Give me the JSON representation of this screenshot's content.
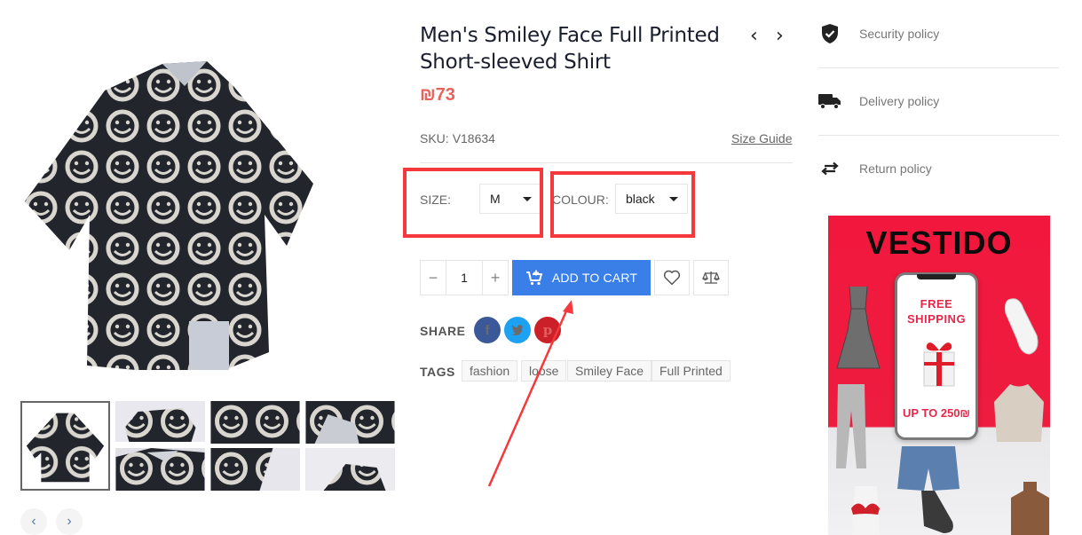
{
  "product": {
    "title": "Men's Smiley Face Full Printed Short-sleeved Shirt",
    "price": "₪73",
    "sku_label": "SKU:",
    "sku_value": "V18634",
    "size_guide": "Size Guide",
    "prev_product": "‹",
    "next_product": "›"
  },
  "options": {
    "size_label": "SIZE:",
    "size_value": "M",
    "colour_label": "COLOUR:",
    "colour_value": "black"
  },
  "cart": {
    "quantity": "1",
    "minus": "−",
    "plus": "+",
    "add_to_cart": "ADD TO CART"
  },
  "share": {
    "label": "SHARE",
    "networks": [
      {
        "name": "facebook",
        "glyph": "f",
        "color": "#3b5998"
      },
      {
        "name": "twitter",
        "glyph": "t",
        "color": "#1da1f2"
      },
      {
        "name": "pinterest",
        "glyph": "p",
        "color": "#cb2027"
      }
    ]
  },
  "tags": {
    "label": "TAGS",
    "items": [
      "fashion",
      "loose",
      "Smiley Face",
      "Full Printed"
    ]
  },
  "gallery": {
    "thumbnail_count": 7,
    "active_index": 0,
    "prev": "‹",
    "next": "›"
  },
  "policies": [
    {
      "label": "Security policy",
      "icon": "shield-check-icon"
    },
    {
      "label": "Delivery policy",
      "icon": "truck-icon"
    },
    {
      "label": "Return policy",
      "icon": "exchange-arrows-icon"
    }
  ],
  "banner": {
    "brand": "VESTIDO",
    "line1": "FREE",
    "line2": "SHIPPING",
    "offer": "UP TO 250₪"
  },
  "colors": {
    "accent": "#3a7ee8",
    "price": "#e8615a",
    "annotation": "#f5383b"
  }
}
